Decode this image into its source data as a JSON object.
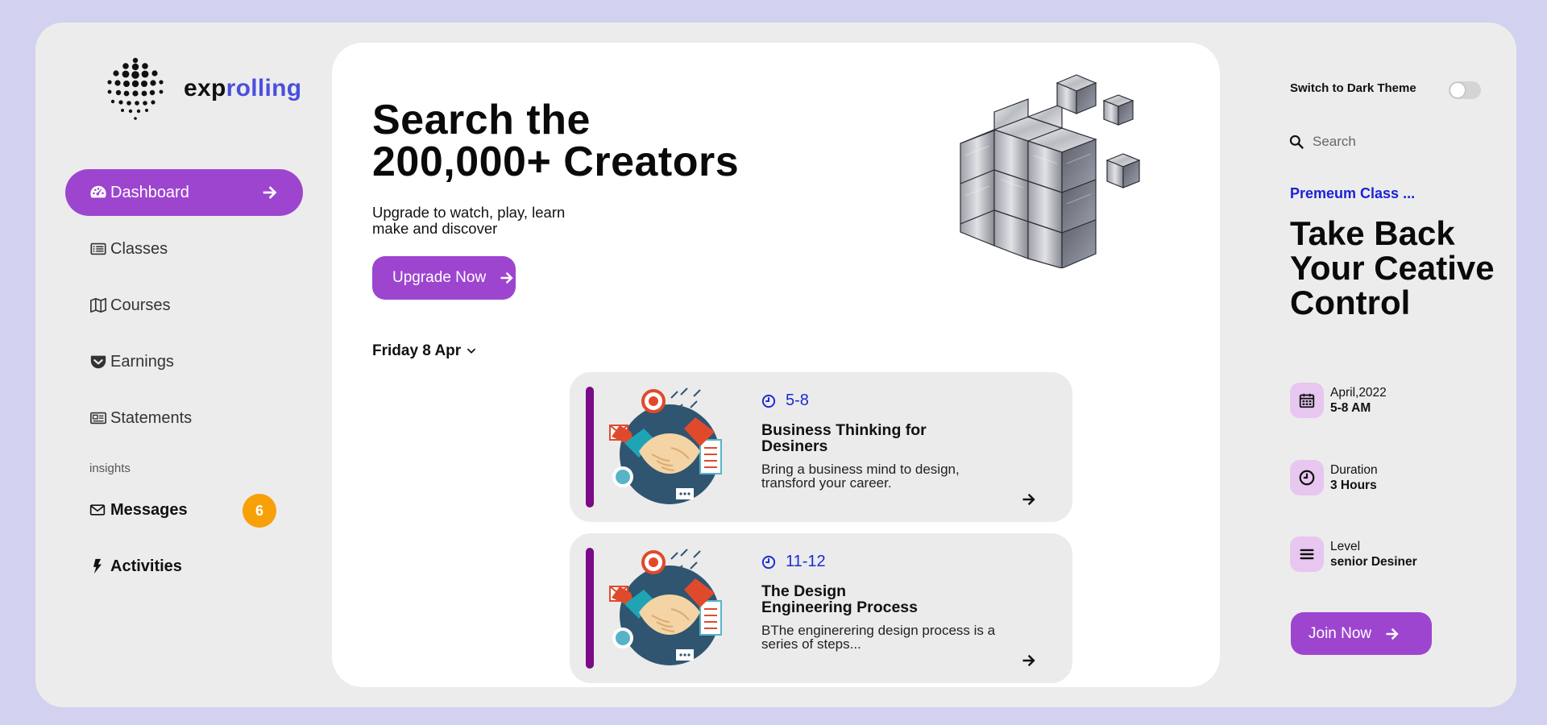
{
  "brand": {
    "name_part1": "exp",
    "name_part2": "rolling",
    "accent_color": "#4a4fe0"
  },
  "colors": {
    "primary": "#9d45cf",
    "badge": "#f7a008",
    "time": "#1a2bd4",
    "card_bar": "#7a0a86"
  },
  "sidebar": {
    "items": [
      {
        "label": "Dashboard",
        "icon": "gauge-icon",
        "active": true
      },
      {
        "label": "Classes",
        "icon": "list-card-icon"
      },
      {
        "label": "Courses",
        "icon": "map-icon"
      },
      {
        "label": "Earnings",
        "icon": "pocket-icon"
      },
      {
        "label": "Statements",
        "icon": "newspaper-icon"
      }
    ],
    "section_label": "insights",
    "messages": {
      "label": "Messages",
      "icon": "envelope-icon",
      "count": "6"
    },
    "activities": {
      "label": "Activities",
      "icon": "bolt-icon"
    }
  },
  "hero": {
    "title_line1": "Search the",
    "title_line2": "200,000+ Creators",
    "subtitle_line1": "Upgrade to watch, play, learn",
    "subtitle_line2": "make and discover",
    "button_label": "Upgrade Now"
  },
  "schedule": {
    "date": "Friday 8 Apr",
    "cards": [
      {
        "time": "5-8",
        "title_line1": "Business Thinking for",
        "title_line2": "Desiners",
        "desc_line1": "Bring a business mind to design,",
        "desc_line2": "transford your career."
      },
      {
        "time": "11-12",
        "title_line1": "The Design",
        "title_line2": "Engineering Process",
        "desc_line1": "BThe enginerering design process is a",
        "desc_line2": "series of steps..."
      }
    ]
  },
  "right": {
    "theme_label": "Switch to Dark Theme",
    "theme_dark_enabled": false,
    "search_placeholder": "Search",
    "kicker": "Premeum Class ...",
    "title_line1": "Take Back",
    "title_line2": "Your Ceative",
    "title_line3": "Control",
    "meta": [
      {
        "icon": "calendar-icon",
        "label": "April,2022",
        "value": "5-8 AM"
      },
      {
        "icon": "clock-icon",
        "label": "Duration",
        "value": "3 Hours"
      },
      {
        "icon": "bars-icon",
        "label": "Level",
        "value": "senior Desiner"
      }
    ],
    "join_label": "Join Now"
  }
}
